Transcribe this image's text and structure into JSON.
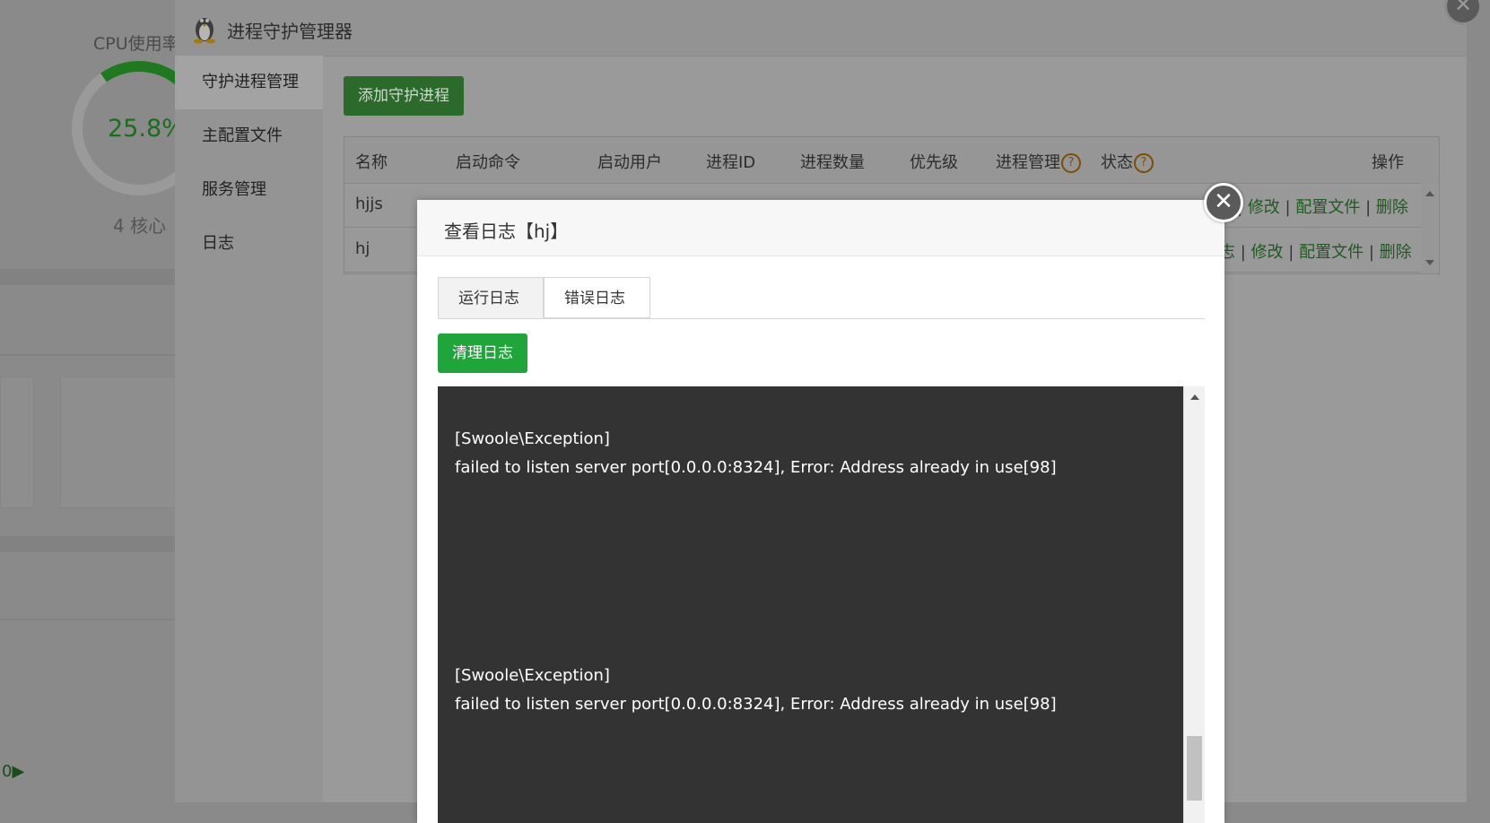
{
  "background": {
    "cpu_title": "CPU使用率",
    "cpu_value": "25.8%",
    "cpu_percent": 25.8,
    "cores": "4 核心"
  },
  "manager": {
    "title": "进程守护管理器",
    "icon": "tux-penguin-icon",
    "sidebar": [
      "守护进程管理",
      "主配置文件",
      "服务管理",
      "日志"
    ],
    "active_sidebar": "守护进程管理",
    "add_button": "添加守护进程",
    "table": {
      "headers": [
        "名称",
        "启动命令",
        "启动用户",
        "进程ID",
        "进程数量",
        "优先级",
        "进程管理",
        "状态",
        "操作"
      ],
      "help_icon": "?",
      "rows": [
        {
          "name": "hjjs",
          "ops": [
            "修改",
            "配置文件",
            "删除"
          ]
        },
        {
          "name": "hj",
          "ops_prefix": "志",
          "ops": [
            "修改",
            "配置文件",
            "删除"
          ]
        }
      ],
      "separator": "|"
    }
  },
  "dialog": {
    "title": "查看日志【hj】",
    "close_icon": "✕",
    "tabs": [
      "运行日志",
      "错误日志"
    ],
    "active_tab": "运行日志",
    "clear_button": "清理日志",
    "log_lines": [
      "[Swoole\\Exception]",
      "failed to listen server port[0.0.0.0:8324], Error: Address already in use[98]",
      "[Swoole\\Exception]",
      "failed to listen server port[0.0.0.0:8324], Error: Address already in use[98]"
    ]
  },
  "colors": {
    "accent_green": "#20a53a",
    "log_bg": "#333333",
    "help_orange": "#e39400"
  }
}
